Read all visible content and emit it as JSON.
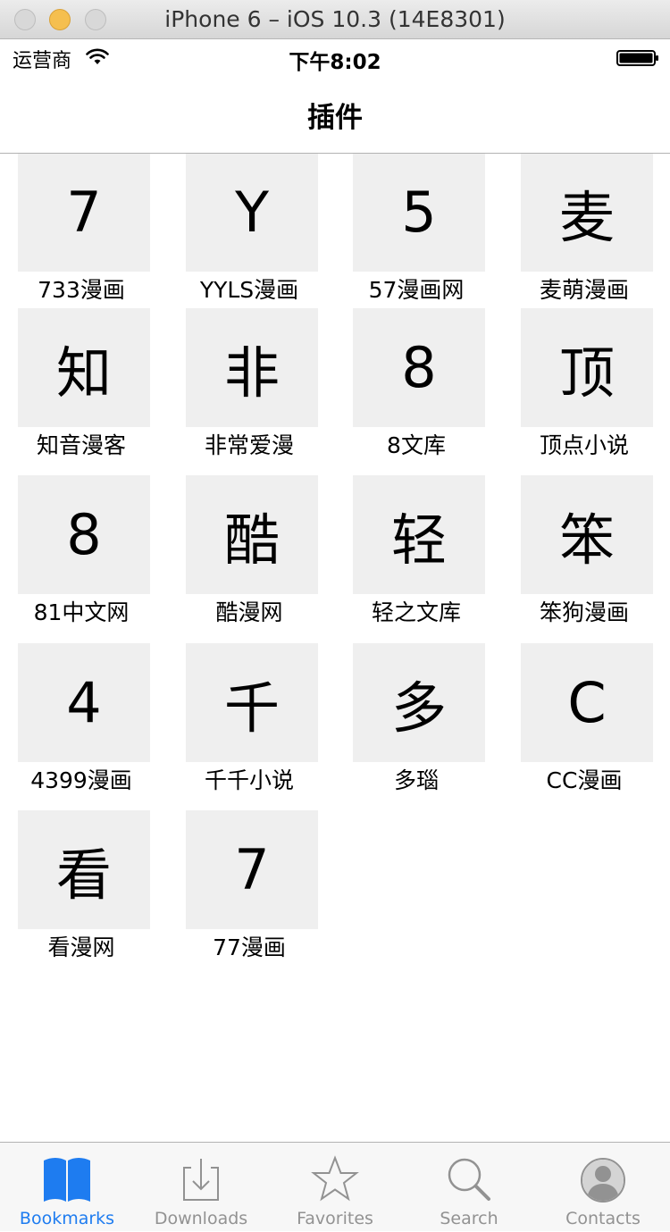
{
  "window": {
    "title": "iPhone 6 – iOS 10.3 (14E8301)"
  },
  "status_bar": {
    "carrier": "运营商",
    "time": "下午8:02"
  },
  "nav": {
    "title": "插件"
  },
  "plugins": [
    {
      "glyph": "7",
      "label": "733漫画"
    },
    {
      "glyph": "Y",
      "label": "YYLS漫画"
    },
    {
      "glyph": "5",
      "label": "57漫画网"
    },
    {
      "glyph": "麦",
      "label": "麦萌漫画"
    },
    {
      "glyph": "知",
      "label": "知音漫客"
    },
    {
      "glyph": "非",
      "label": "非常爱漫"
    },
    {
      "glyph": "8",
      "label": "8文库"
    },
    {
      "glyph": "顶",
      "label": "顶点小说"
    },
    {
      "glyph": "8",
      "label": "81中文网"
    },
    {
      "glyph": "酷",
      "label": "酷漫网"
    },
    {
      "glyph": "轻",
      "label": "轻之文库"
    },
    {
      "glyph": "笨",
      "label": "笨狗漫画"
    },
    {
      "glyph": "4",
      "label": "4399漫画"
    },
    {
      "glyph": "千",
      "label": "千千小说"
    },
    {
      "glyph": "多",
      "label": "多瑙"
    },
    {
      "glyph": "C",
      "label": "CC漫画"
    },
    {
      "glyph": "看",
      "label": "看漫网"
    },
    {
      "glyph": "7",
      "label": "77漫画"
    }
  ],
  "tabs": [
    {
      "label": "Bookmarks",
      "icon": "bookmarks-icon",
      "active": true
    },
    {
      "label": "Downloads",
      "icon": "downloads-icon",
      "active": false
    },
    {
      "label": "Favorites",
      "icon": "favorites-icon",
      "active": false
    },
    {
      "label": "Search",
      "icon": "search-icon",
      "active": false
    },
    {
      "label": "Contacts",
      "icon": "contacts-icon",
      "active": false
    }
  ],
  "colors": {
    "accent": "#1e7cf0",
    "inactive": "#929292",
    "tile": "#efefef"
  }
}
